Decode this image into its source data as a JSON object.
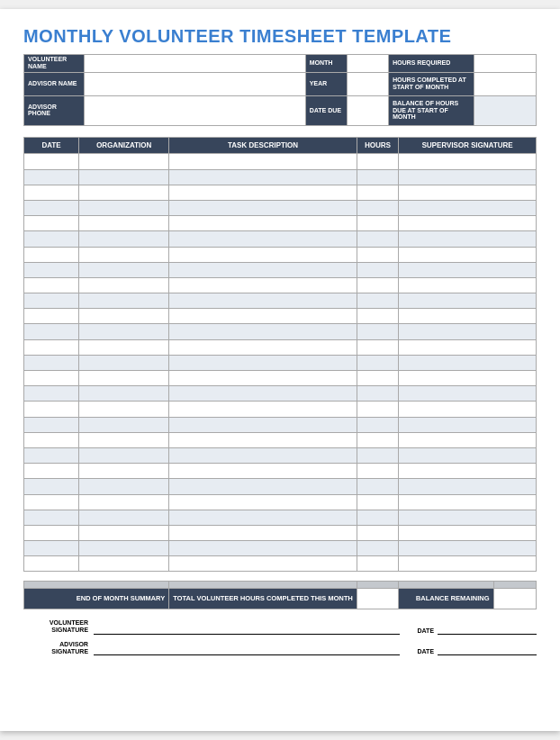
{
  "title": "MONTHLY VOLUNTEER TIMESHEET TEMPLATE",
  "info": {
    "volunteer_name_label": "VOLUNTEER NAME",
    "advisor_name_label": "ADVISOR NAME",
    "advisor_phone_label": "ADVISOR PHONE",
    "month_label": "MONTH",
    "year_label": "YEAR",
    "date_due_label": "DATE DUE",
    "hours_required_label": "HOURS REQUIRED",
    "hours_completed_label": "HOURS COMPLETED AT START OF MONTH",
    "balance_due_label": "BALANCE OF HOURS DUE AT START OF MONTH",
    "volunteer_name": "",
    "advisor_name": "",
    "advisor_phone": "",
    "month": "",
    "year": "",
    "date_due": "",
    "hours_required": "",
    "hours_completed": "",
    "balance_due": ""
  },
  "columns": {
    "date": "DATE",
    "organization": "ORGANIZATION",
    "task": "TASK DESCRIPTION",
    "hours": "HOURS",
    "signature": "SUPERVISOR SIGNATURE"
  },
  "rows": [
    {
      "date": "",
      "organization": "",
      "task": "",
      "hours": "",
      "signature": ""
    },
    {
      "date": "",
      "organization": "",
      "task": "",
      "hours": "",
      "signature": ""
    },
    {
      "date": "",
      "organization": "",
      "task": "",
      "hours": "",
      "signature": ""
    },
    {
      "date": "",
      "organization": "",
      "task": "",
      "hours": "",
      "signature": ""
    },
    {
      "date": "",
      "organization": "",
      "task": "",
      "hours": "",
      "signature": ""
    },
    {
      "date": "",
      "organization": "",
      "task": "",
      "hours": "",
      "signature": ""
    },
    {
      "date": "",
      "organization": "",
      "task": "",
      "hours": "",
      "signature": ""
    },
    {
      "date": "",
      "organization": "",
      "task": "",
      "hours": "",
      "signature": ""
    },
    {
      "date": "",
      "organization": "",
      "task": "",
      "hours": "",
      "signature": ""
    },
    {
      "date": "",
      "organization": "",
      "task": "",
      "hours": "",
      "signature": ""
    },
    {
      "date": "",
      "organization": "",
      "task": "",
      "hours": "",
      "signature": ""
    },
    {
      "date": "",
      "organization": "",
      "task": "",
      "hours": "",
      "signature": ""
    },
    {
      "date": "",
      "organization": "",
      "task": "",
      "hours": "",
      "signature": ""
    },
    {
      "date": "",
      "organization": "",
      "task": "",
      "hours": "",
      "signature": ""
    },
    {
      "date": "",
      "organization": "",
      "task": "",
      "hours": "",
      "signature": ""
    },
    {
      "date": "",
      "organization": "",
      "task": "",
      "hours": "",
      "signature": ""
    },
    {
      "date": "",
      "organization": "",
      "task": "",
      "hours": "",
      "signature": ""
    },
    {
      "date": "",
      "organization": "",
      "task": "",
      "hours": "",
      "signature": ""
    },
    {
      "date": "",
      "organization": "",
      "task": "",
      "hours": "",
      "signature": ""
    },
    {
      "date": "",
      "organization": "",
      "task": "",
      "hours": "",
      "signature": ""
    },
    {
      "date": "",
      "organization": "",
      "task": "",
      "hours": "",
      "signature": ""
    },
    {
      "date": "",
      "organization": "",
      "task": "",
      "hours": "",
      "signature": ""
    },
    {
      "date": "",
      "organization": "",
      "task": "",
      "hours": "",
      "signature": ""
    },
    {
      "date": "",
      "organization": "",
      "task": "",
      "hours": "",
      "signature": ""
    },
    {
      "date": "",
      "organization": "",
      "task": "",
      "hours": "",
      "signature": ""
    },
    {
      "date": "",
      "organization": "",
      "task": "",
      "hours": "",
      "signature": ""
    },
    {
      "date": "",
      "organization": "",
      "task": "",
      "hours": "",
      "signature": ""
    }
  ],
  "summary": {
    "end_label": "END OF MONTH SUMMARY",
    "total_label": "TOTAL VOLUNTEER HOURS COMPLETED THIS MONTH",
    "balance_label": "BALANCE REMAINING",
    "total_value": "",
    "balance_value": ""
  },
  "signatures": {
    "volunteer_label": "VOLUNTEER SIGNATURE",
    "advisor_label": "ADVISOR SIGNATURE",
    "date_label": "DATE"
  }
}
